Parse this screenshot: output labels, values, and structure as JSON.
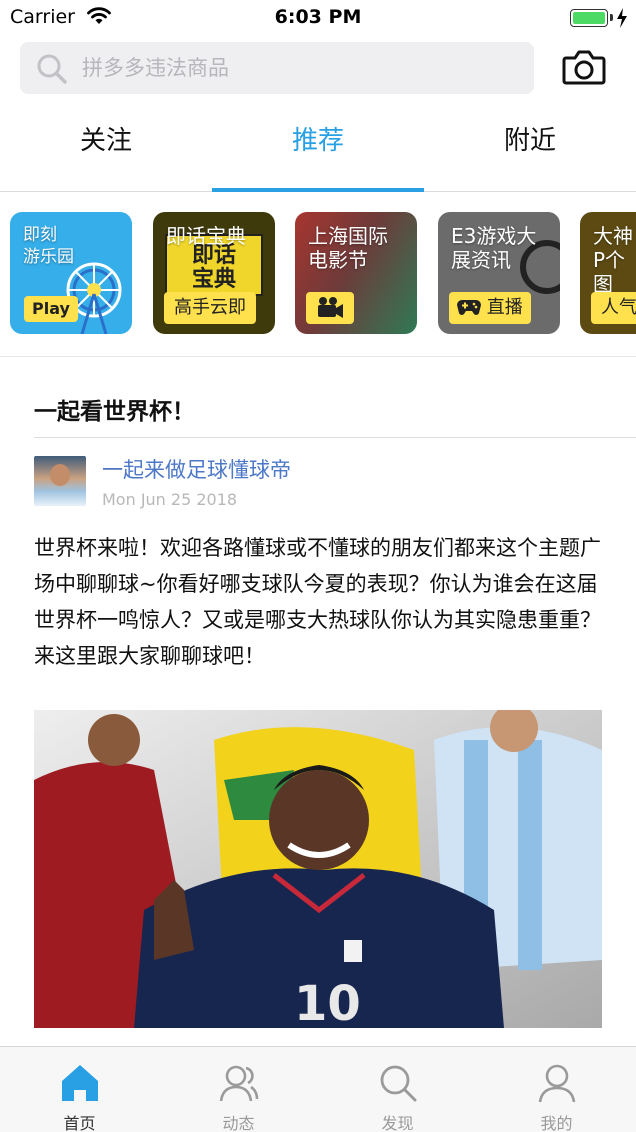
{
  "status_bar": {
    "carrier": "Carrier",
    "time": "6:03 PM",
    "battery_level": 1.0,
    "battery_color": "#4cd964"
  },
  "search": {
    "placeholder": "拼多多违法商品",
    "value": ""
  },
  "tabs": [
    {
      "label": "关注",
      "active": false
    },
    {
      "label": "推荐",
      "active": true
    },
    {
      "label": "附近",
      "active": false
    }
  ],
  "accent_color": "#29a0e3",
  "topics": [
    {
      "title": "即刻\n游乐园",
      "badge": "Play",
      "icon": "ferris-wheel-icon"
    },
    {
      "title": "即话宝典",
      "inner": "即话\n宝典",
      "badge": "高手云即"
    },
    {
      "title": "上海国际\n电影节",
      "badge_icon": "video-camera-icon"
    },
    {
      "title": "E3游戏大\n展资讯",
      "badge": "直播",
      "badge_icon": "gamepad-icon"
    },
    {
      "title": "大神\nP个图",
      "badge": "人气"
    }
  ],
  "post": {
    "section_title": "一起看世界杯！",
    "author": "一起来做足球懂球帝",
    "date": "Mon Jun 25 2018",
    "body": "世界杯来啦！欢迎各路懂球或不懂球的朋友们都来这个主题广场中聊聊球~你看好哪支球队今夏的表现？你认为谁会在这届世界杯一鸣惊人？又或是哪支大热球队你认为其实隐患重重？来这里跟大家聊聊球吧！"
  },
  "tabbar": [
    {
      "label": "首页",
      "icon": "home-icon",
      "active": true
    },
    {
      "label": "动态",
      "icon": "friends-icon",
      "active": false
    },
    {
      "label": "发现",
      "icon": "search-icon",
      "active": false
    },
    {
      "label": "我的",
      "icon": "person-icon",
      "active": false
    }
  ]
}
